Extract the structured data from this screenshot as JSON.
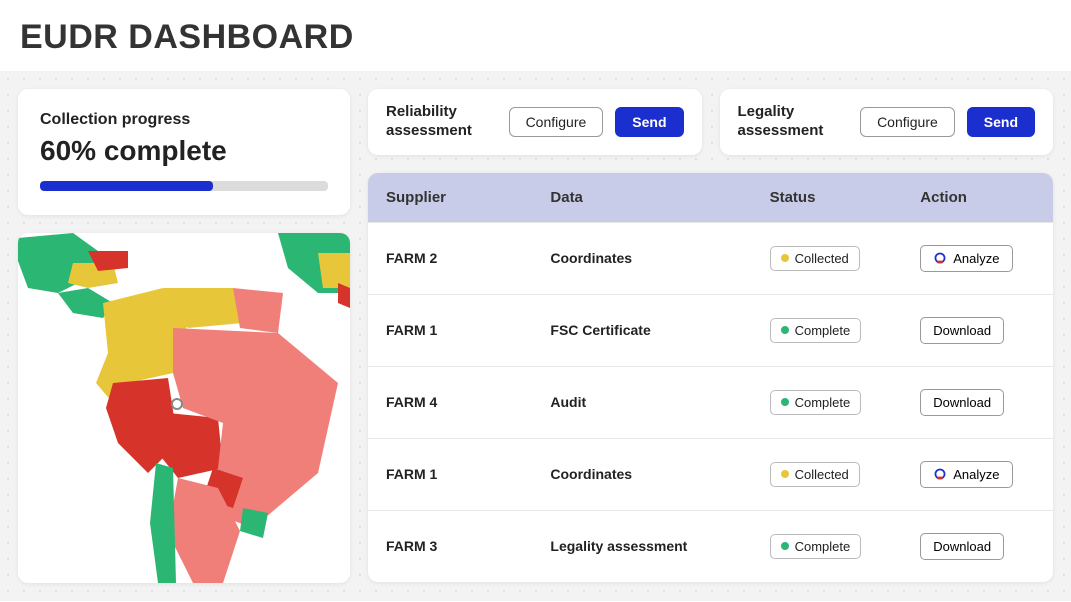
{
  "title": "EUDR DASHBOARD",
  "progress": {
    "label": "Collection progress",
    "value_text": "60% complete",
    "percent": 60
  },
  "assessments": {
    "reliability": {
      "title": "Reliability assessment",
      "configure_label": "Configure",
      "send_label": "Send"
    },
    "legality": {
      "title": "Legality assessment",
      "configure_label": "Configure",
      "send_label": "Send"
    }
  },
  "table": {
    "headers": {
      "supplier": "Supplier",
      "data": "Data",
      "status": "Status",
      "action": "Action"
    },
    "rows": [
      {
        "supplier": "FARM 2",
        "data": "Coordinates",
        "status": "Collected",
        "status_color": "yellow",
        "action": "Analyze",
        "action_icon": "analyze"
      },
      {
        "supplier": "FARM 1",
        "data": "FSC Certificate",
        "status": "Complete",
        "status_color": "green",
        "action": "Download",
        "action_icon": "none"
      },
      {
        "supplier": "FARM 4",
        "data": "Audit",
        "status": "Complete",
        "status_color": "green",
        "action": "Download",
        "action_icon": "none"
      },
      {
        "supplier": "FARM 1",
        "data": "Coordinates",
        "status": "Collected",
        "status_color": "yellow",
        "action": "Analyze",
        "action_icon": "analyze"
      },
      {
        "supplier": "FARM 3",
        "data": "Legality assessment",
        "status": "Complete",
        "status_color": "green",
        "action": "Download",
        "action_icon": "none"
      }
    ]
  },
  "colors": {
    "accent": "#1b2fce",
    "status_yellow": "#e8c63a",
    "status_green": "#2bb673",
    "map_green": "#2bb673",
    "map_yellow": "#e8c63a",
    "map_red": "#d6332a",
    "map_pink": "#f07f7a"
  }
}
